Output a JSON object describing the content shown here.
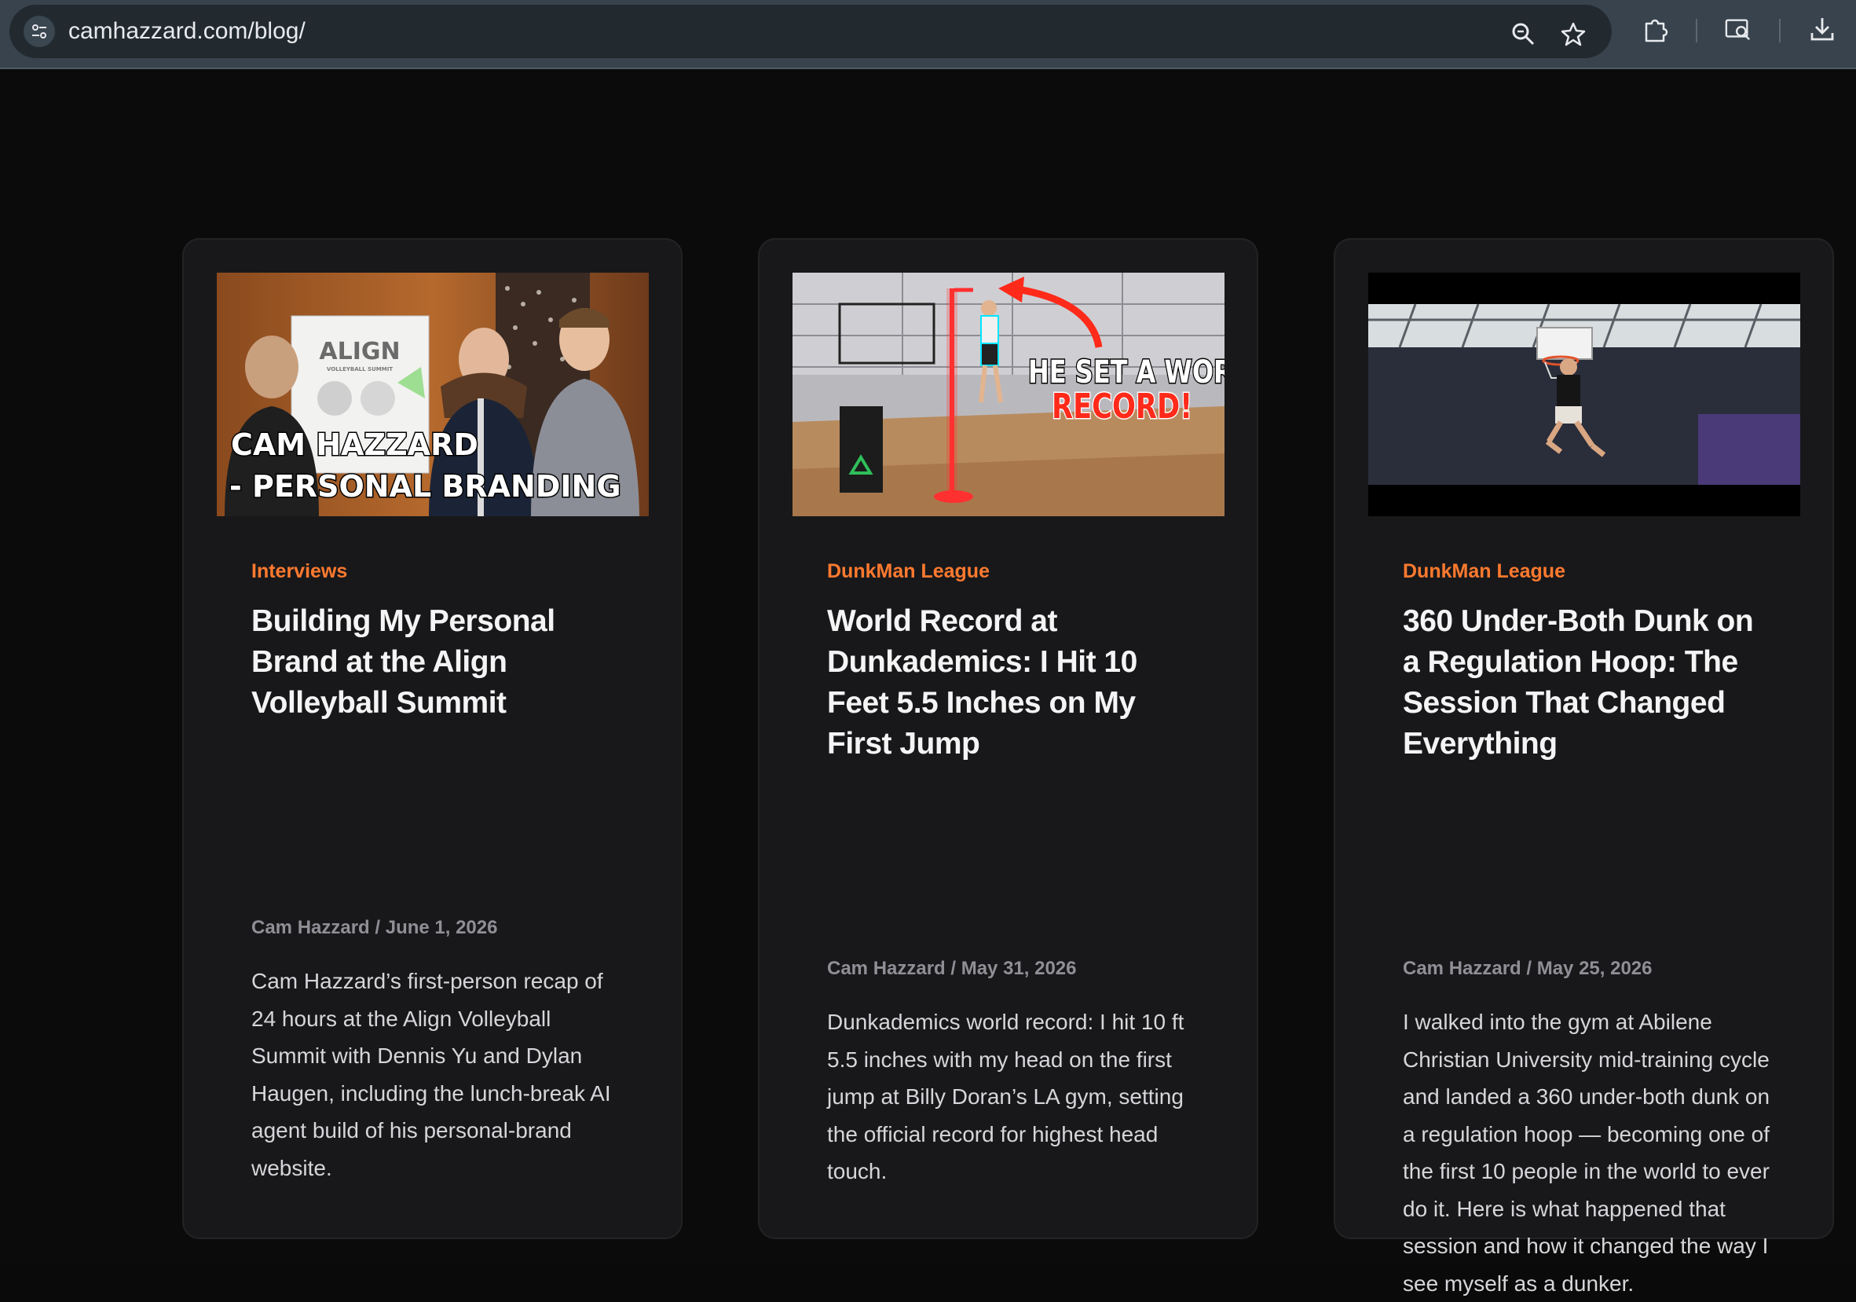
{
  "browser": {
    "url": "camhazzard.com/blog/"
  },
  "posts": [
    {
      "category": "Interviews",
      "title": "Building My Personal Brand at the Align Volleyball Summit",
      "meta": "Cam Hazzard / June 1, 2026",
      "excerpt": "Cam Hazzard’s first-person recap of 24 hours at the Align Volleyball Summit with Dennis Yu and Dylan Haugen, including the lunch-break AI agent build of his personal-brand website.",
      "thumb": {
        "line1": "CAM HAZZARD",
        "line2": "- PERSONAL BRANDING",
        "banner_logo": "ALIGN",
        "banner_sub": "VOLLEYBALL SUMMIT"
      }
    },
    {
      "category": "DunkMan League",
      "title": "World Record at Dunkademics: I Hit 10 Feet 5.5 Inches on My First Jump",
      "meta": "Cam Hazzard / May 31, 2026",
      "excerpt": "Dunkademics world record: I hit 10 ft 5.5 inches with my head on the first jump at Billy Doran’s LA gym, setting the official record for highest head touch.",
      "thumb": {
        "line1": "HE SET A WORLD",
        "line2": "RECORD!"
      }
    },
    {
      "category": "DunkMan League",
      "title": "360 Under-Both Dunk on a Regulation Hoop: The Session That Changed Everything",
      "meta": "Cam Hazzard / May 25, 2026",
      "excerpt": "I walked into the gym at Abilene Christian University mid-training cycle and landed a 360 under-both dunk on a regulation hoop — becoming one of the first 10 people in the world to ever do it. Here is what happened that session and how it changed the way I see myself as a dunker.",
      "thumb": {}
    }
  ],
  "colors": {
    "accent": "#ff7a2f",
    "card_bg": "#18181a",
    "page_bg": "#0b0b0b"
  }
}
